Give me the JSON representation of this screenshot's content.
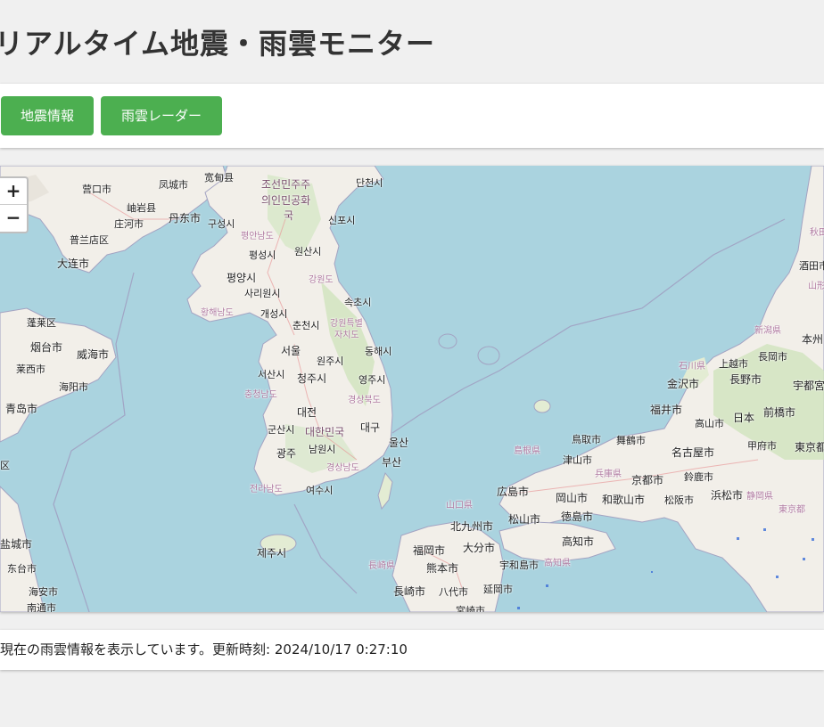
{
  "header": {
    "title": "リアルタイム地震・雨雲モニター"
  },
  "toolbar": {
    "earthquake_label": "地震情報",
    "rain_label": "雨雲レーダー",
    "accent_color": "#4caf50"
  },
  "map": {
    "zoom_in": "+",
    "zoom_out": "−",
    "labels": {
      "yingkou": "营口市",
      "fengcheng": "凤城市",
      "kuandian": "宽甸县",
      "xiuyan": "岫岩县",
      "zhuanghe": "庄河市",
      "dandong": "丹东市",
      "pulandian": "普兰店区",
      "dalian": "大连市",
      "penglai": "蓬莱区",
      "yantai": "烟台市",
      "weihai": "威海市",
      "laixi": "莱西市",
      "haiyang": "海阳市",
      "qingdao": "青岛市",
      "dprk1": "조선민주주",
      "dprk2": "의인민공화",
      "dprk3": "국",
      "danchon": "단천시",
      "sinpo": "신포시",
      "kusong": "구성시",
      "pyonganbuk": "평안남도",
      "pyongsong": "평성시",
      "wonsan": "원산시",
      "pyongyang": "평양시",
      "sariwon": "사리원시",
      "gangwon_n": "강원도",
      "hwanghae": "황해남도",
      "kaesong": "개성시",
      "sokcho": "속초시",
      "chuncheon": "춘천시",
      "gangwon_s": "강원특별",
      "gangwon_s2": "자치도",
      "seoul": "서울",
      "donghae": "동해시",
      "wonju": "원주시",
      "seosan": "서산시",
      "cheongju": "청주시",
      "yeongju": "영주시",
      "chungnam": "충청남도",
      "gyeongbuk": "경상북도",
      "daejeon": "대전",
      "daegu": "대구",
      "gunsan": "군산시",
      "rok": "대한민국",
      "ulsan": "울산",
      "gwangju": "광주",
      "namwon": "남원시",
      "busan": "부산",
      "gyeongnam": "경상남도",
      "jeonnam": "전라남도",
      "yeosu": "여수시",
      "jeju": "제주시",
      "jiangsu_qu": "区",
      "yancheng": "盐城市",
      "dongtai": "东台市",
      "haian": "海安市",
      "nantong": "南通市",
      "honshu": "本州",
      "akita": "秋田",
      "sakata": "酒田市",
      "yamagata": "山形",
      "niigata_pref": "新潟県",
      "nagaoka": "長岡市",
      "ishikawa": "石川県",
      "joetsu": "上越市",
      "kanazawa": "金沢市",
      "nagano": "長野市",
      "utsunomiya": "宇都宮",
      "fukui": "福井市",
      "takayama": "高山市",
      "japan": "日本",
      "maebashi": "前橋市",
      "shimane": "島根県",
      "tottori": "鳥取市",
      "maizuru": "舞鶴市",
      "nagoya": "名古屋市",
      "tsuyama": "津山市",
      "hyogo": "兵庫県",
      "kofu": "甲府市",
      "tokyo": "東京都",
      "kyoto": "京都市",
      "suzuka": "鈴鹿市",
      "shizuoka": "静岡県",
      "yamaguchi": "山口県",
      "hiroshima": "広島市",
      "okayama": "岡山市",
      "wakayama": "和歌山市",
      "matsusaka": "松阪市",
      "hamamatsu": "浜松市",
      "tokyo_to": "東京都",
      "kitakyushu": "北九州市",
      "matsuyama": "松山市",
      "tokushima": "徳島市",
      "fukuoka": "福岡市",
      "oita": "大分市",
      "kochi": "高知市",
      "nagasaki_pref": "長崎県",
      "kumamoto": "熊本市",
      "uwajima": "宇和島市",
      "kochi_pref": "高知県",
      "nagasaki": "長崎市",
      "yatsushiro": "八代市",
      "nobeoka": "延岡市",
      "miyazaki": "宮崎市"
    }
  },
  "status": {
    "message": "現在の雨雲情報を表示しています。更新時刻: 2024/10/17 0:27:10"
  }
}
